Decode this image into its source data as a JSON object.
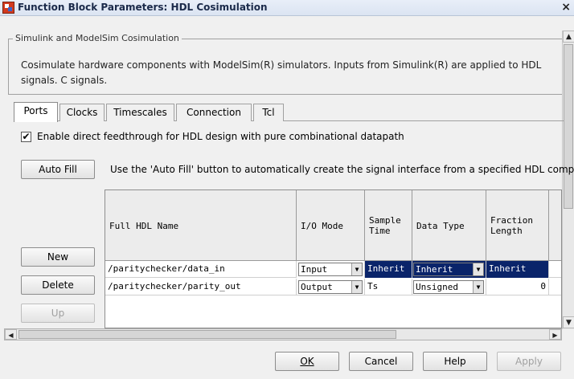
{
  "window": {
    "title": "Function Block Parameters: HDL Cosimulation",
    "close": "×"
  },
  "group": {
    "legend": "Simulink and ModelSim Cosimulation",
    "description": "Cosimulate hardware components with ModelSim(R) simulators. Inputs from Simulink(R) are applied to HDL signals. C signals."
  },
  "tabs": [
    {
      "label": "Ports",
      "active": true
    },
    {
      "label": "Clocks"
    },
    {
      "label": "Timescales"
    },
    {
      "label": "Connection"
    },
    {
      "label": "Tcl"
    }
  ],
  "ports": {
    "checkbox_checked": true,
    "checkbox_mark": "✔",
    "checkbox_label": "Enable direct feedthrough for HDL design with pure combinational datapath",
    "autofill_button": "Auto Fill",
    "autofill_text": "Use the 'Auto Fill' button to automatically create the signal interface from a specified HDL compon",
    "side_buttons": {
      "new": "New",
      "delete": "Delete",
      "up": "Up"
    }
  },
  "table": {
    "headers": [
      "Full HDL Name",
      "I/O Mode",
      "Sample Time",
      "Data Type",
      "Fraction Length"
    ],
    "rows": [
      {
        "name": "/paritychecker/data_in",
        "io_mode": "Input",
        "sample_time": "Inherit",
        "data_type": "Inherit",
        "fraction_length": "Inherit",
        "selected": true
      },
      {
        "name": "/paritychecker/parity_out",
        "io_mode": "Output",
        "sample_time": "Ts",
        "data_type": "Unsigned",
        "fraction_length": "0",
        "selected": false
      }
    ]
  },
  "buttons": {
    "ok": "OK",
    "cancel": "Cancel",
    "help": "Help",
    "apply": "Apply"
  },
  "icons": {
    "dd_arrow": "▼",
    "scroll_up": "▲",
    "scroll_down": "▼",
    "scroll_left": "◀",
    "scroll_right": "▶"
  }
}
